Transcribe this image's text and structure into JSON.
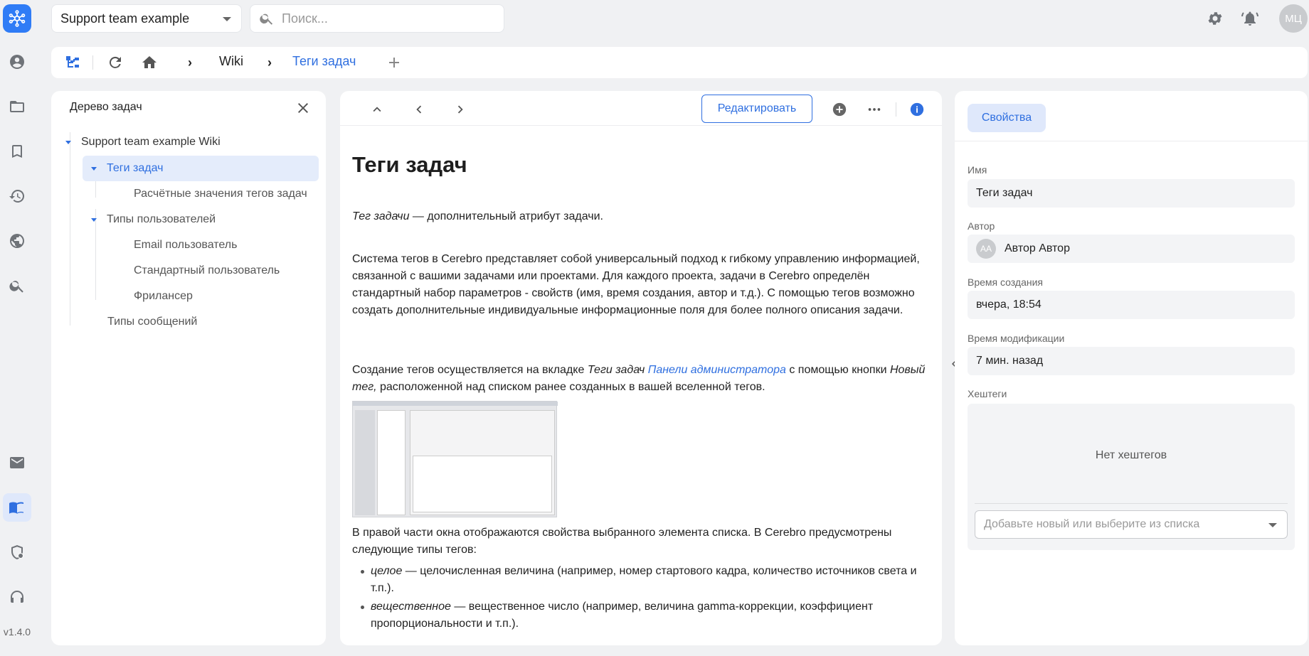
{
  "app": {
    "project": "Support team example",
    "search_placeholder": "Поиск...",
    "user_initials": "МЦ",
    "version": "v1.4.0"
  },
  "breadcrumb": {
    "items": [
      "Wiki",
      "Теги задач"
    ]
  },
  "tree": {
    "title": "Дерево задач",
    "items": [
      {
        "label": "Support team example Wiki"
      },
      {
        "label": "Теги задач"
      },
      {
        "label": "Расчётные значения тегов задач"
      },
      {
        "label": "Типы пользователей"
      },
      {
        "label": "Email пользователь"
      },
      {
        "label": "Стандартный пользователь"
      },
      {
        "label": "Фрилансер"
      },
      {
        "label": "Типы сообщений"
      }
    ]
  },
  "content": {
    "edit_label": "Редактировать",
    "title": "Теги задач",
    "p1_em": "Тег задачи",
    "p1_rest": " — дополнительный атрибут задачи.",
    "p2": "Система тегов в Cerebro представляет собой универсальный подход к гибкому управлению информацией, связанной с вашими задачами или проектами. Для каждого проекта, задачи в Cerebro определён стандартный набор параметров - свойств (имя, время создания, автор и т.д.). С помощью тегов возможно создать дополнительные индивидуальные информационные поля для более полного описания задачи.",
    "p3_a": "Создание тегов осуществляется на вкладке ",
    "p3_em1": "Теги задач",
    "p3_link": "Панели администратора",
    "p3_b": " с помощью кнопки ",
    "p3_em2": "Новый тег,",
    "p3_c": " расположенной над списком ранее созданных в вашей вселенной тегов.",
    "p4": "В правой части окна отображаются свойства выбранного элемента списка. В Cerebro предусмотрены следующие типы тегов:",
    "list": [
      {
        "em": "целое",
        "rest": " — целочисленная величина (например, номер стартового кадра, количество источников света и т.п.)."
      },
      {
        "em": "вещественное",
        "rest": " — вещественное число (например, величина gamma-коррекции, коэффициент пропорциональности и т.п.)."
      }
    ]
  },
  "properties": {
    "tab_label": "Свойства",
    "name_label": "Имя",
    "name_value": "Теги задач",
    "author_label": "Автор",
    "author_initials": "АА",
    "author_value": "Автор Автор",
    "created_label": "Время создания",
    "created_value": "вчера, 18:54",
    "modified_label": "Время модификации",
    "modified_value": "7 мин. назад",
    "hashtags_label": "Хештеги",
    "no_hashtags": "Нет хештегов",
    "hashtag_placeholder": "Добавьте новый или выберите из списка"
  },
  "colors": {
    "accent": "#2f6fe0",
    "background": "#f0f1f3",
    "selected_bg": "#e4ecfb"
  }
}
